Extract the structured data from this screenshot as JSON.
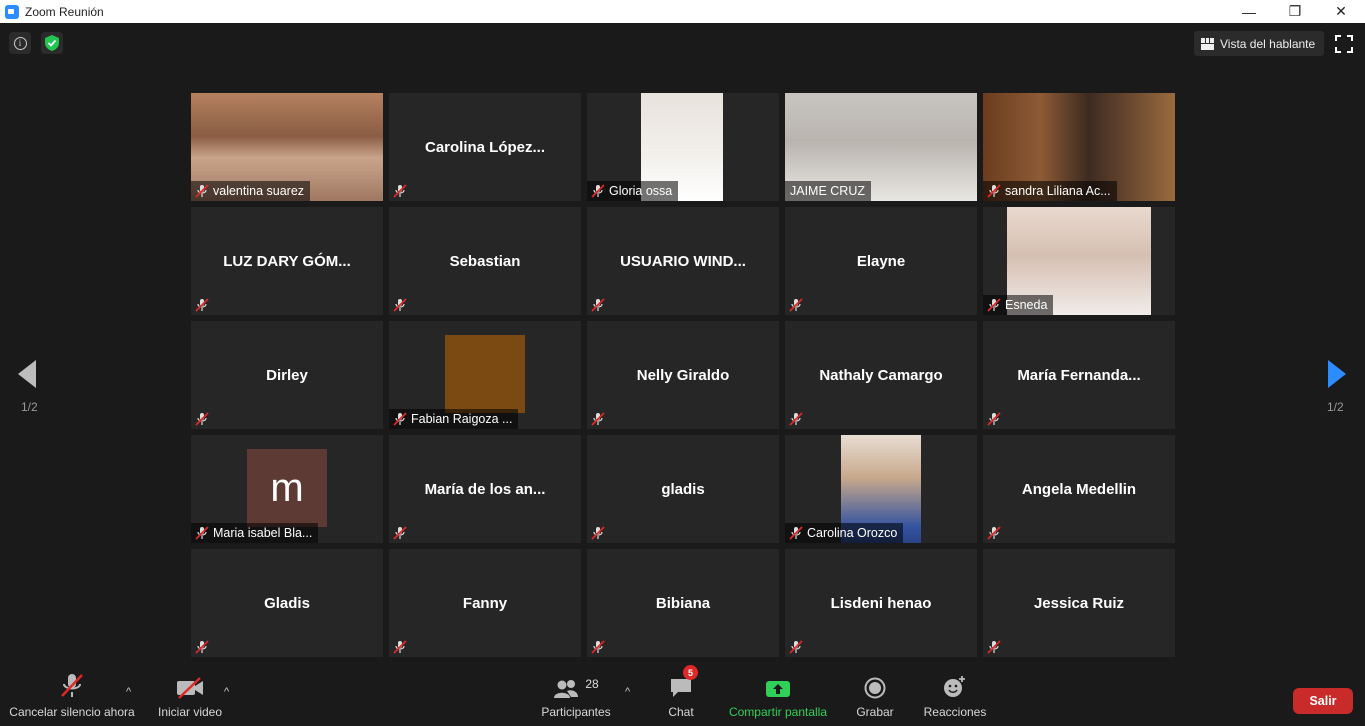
{
  "window": {
    "title": "Zoom Reunión",
    "min": "—",
    "max": "❐",
    "close": "✕"
  },
  "top": {
    "view_label": "Vista del hablante",
    "info_glyph": "i"
  },
  "pagination": {
    "left": "1/2",
    "right": "1/2"
  },
  "tiles": [
    {
      "name": "valentina suarez",
      "label": "valentina suarez",
      "video": true,
      "muted": true
    },
    {
      "name": "Carolina  López...",
      "video": false,
      "muted": true
    },
    {
      "name": "Gloria ossa",
      "label": "Gloria ossa",
      "video": true,
      "muted": true
    },
    {
      "name": "JAIME CRUZ",
      "label": "JAIME CRUZ",
      "video": true,
      "muted": false,
      "active": true
    },
    {
      "name": "sandra Liliana Ac...",
      "label": "sandra Liliana Ac...",
      "video": true,
      "muted": true
    },
    {
      "name": "LUZ DARY GÓM...",
      "video": false,
      "muted": true
    },
    {
      "name": "Sebastian",
      "video": false,
      "muted": true
    },
    {
      "name": "USUARIO WIND...",
      "video": false,
      "muted": true
    },
    {
      "name": "Elayne",
      "video": false,
      "muted": true
    },
    {
      "name": "Esneda",
      "label": "Esneda",
      "video": true,
      "muted": true
    },
    {
      "name": "Dirley",
      "video": false,
      "muted": true
    },
    {
      "name": "Fabian Raigoza ...",
      "label": "Fabian Raigoza ...",
      "video": true,
      "muted": true
    },
    {
      "name": "Nelly Giraldo",
      "video": false,
      "muted": true
    },
    {
      "name": "Nathaly Camargo",
      "video": false,
      "muted": true
    },
    {
      "name": "María  Fernanda...",
      "video": false,
      "muted": true
    },
    {
      "name": "Maria isabel Bla...",
      "label": "Maria isabel Bla...",
      "video": true,
      "avatar_letter": "m",
      "muted": true
    },
    {
      "name": "María de los an...",
      "video": false,
      "muted": true
    },
    {
      "name": "gladis",
      "video": false,
      "muted": true
    },
    {
      "name": "Carolina Orozco",
      "label": "Carolina Orozco",
      "video": true,
      "muted": true
    },
    {
      "name": "Angela Medellin",
      "video": false,
      "muted": true
    },
    {
      "name": "Gladis",
      "video": false,
      "muted": true
    },
    {
      "name": "Fanny",
      "video": false,
      "muted": true
    },
    {
      "name": "Bibiana",
      "video": false,
      "muted": true
    },
    {
      "name": "Lisdeni henao",
      "video": false,
      "muted": true
    },
    {
      "name": "Jessica Ruiz",
      "video": false,
      "muted": true
    }
  ],
  "toolbar": {
    "unmute_label": "Cancelar silencio ahora",
    "video_label": "Iniciar video",
    "participants_label": "Participantes",
    "participants_count": "28",
    "chat_label": "Chat",
    "chat_badge": "5",
    "share_label": "Compartir pantalla",
    "record_label": "Grabar",
    "reactions_label": "Reacciones",
    "leave_label": "Salir",
    "caret": "^"
  },
  "colors": {
    "active_speaker": "#d7ee69",
    "share_green": "#30d158",
    "leave_red": "#c92a2a",
    "zoom_blue": "#2d8cff"
  }
}
